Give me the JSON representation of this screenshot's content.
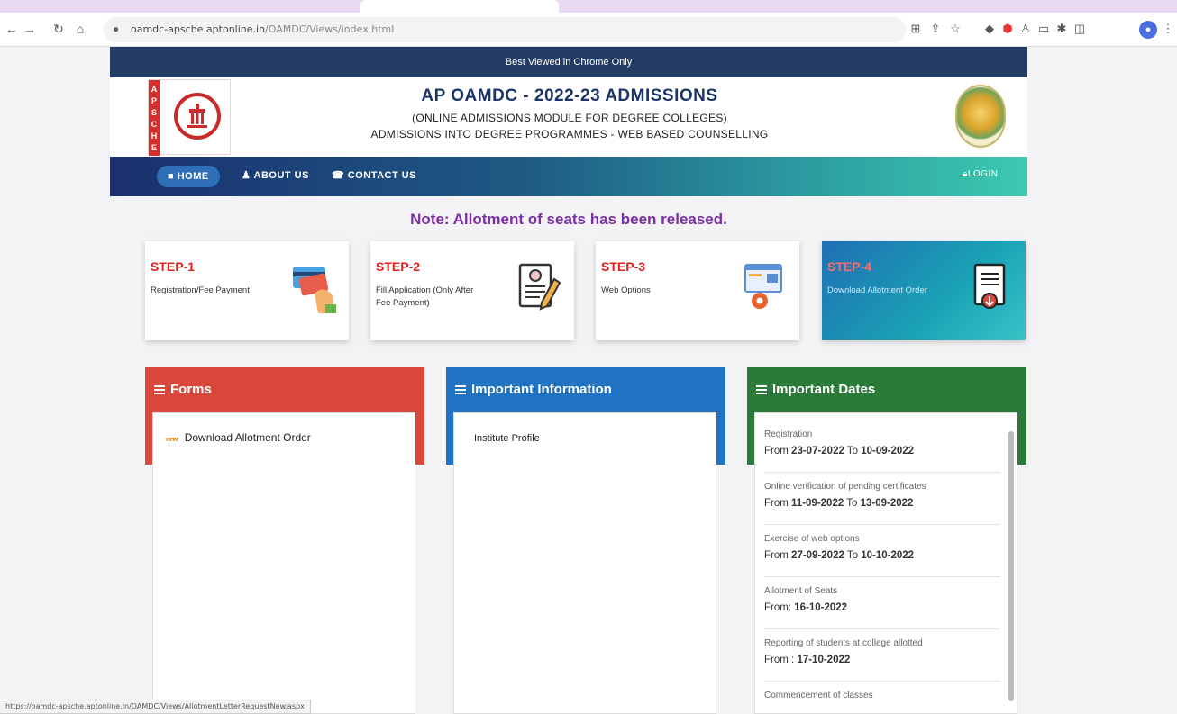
{
  "browser": {
    "url_host": "oamdc-apsche.aptonline.in",
    "url_path": "/OAMDC/Views/index.html",
    "status_url": "https://oamdc-apsche.aptonline.in/OAMDC/Views/AllotmentLetterRequestNew.aspx"
  },
  "site": {
    "notice": "Best Viewed in Chrome Only",
    "title": "AP OAMDC - 2022-23 ADMISSIONS",
    "subtitle1": "(ONLINE ADMISSIONS MODULE FOR DEGREE COLLEGES)",
    "subtitle2": "ADMISSIONS INTO DEGREE PROGRAMMES - WEB BASED COUNSELLING",
    "logo_letters": [
      "A",
      "P",
      "S",
      "C",
      "H",
      "E"
    ]
  },
  "nav": {
    "home": "HOME",
    "about": "ABOUT US",
    "contact": "CONTACT US",
    "login": "LOGIN"
  },
  "note": "Note: Allotment of seats has been released.",
  "steps": [
    {
      "label": "STEP-1",
      "desc": "Registration/Fee Payment"
    },
    {
      "label": "STEP-2",
      "desc": "Fill Application (Only After Fee Payment)"
    },
    {
      "label": "STEP-3",
      "desc": "Web Options"
    },
    {
      "label": "STEP-4",
      "desc": "Download Allotment Order"
    }
  ],
  "panels": {
    "forms": {
      "title": "Forms",
      "badge": "new",
      "link": "Download Allotment Order"
    },
    "info": {
      "title": "Important Information",
      "link": "Institute Profile"
    },
    "dates": {
      "title": "Important Dates",
      "items": [
        {
          "label": "Registration",
          "prefix": "From",
          "from": "23-07-2022",
          "sep": "To",
          "to": "10-09-2022"
        },
        {
          "label": "Online verification of pending certificates",
          "prefix": "From",
          "from": "11-09-2022",
          "sep": "To",
          "to": "13-09-2022"
        },
        {
          "label": "Exercise of web options",
          "prefix": "From",
          "from": "27-09-2022",
          "sep": "To",
          "to": "10-10-2022"
        },
        {
          "label": "Allotment of Seats",
          "prefix": "From:",
          "from": "16-10-2022",
          "sep": "",
          "to": ""
        },
        {
          "label": "Reporting of students at college allotted",
          "prefix": "From :",
          "from": "17-10-2022",
          "sep": "",
          "to": ""
        },
        {
          "label": "Commencement of classes",
          "prefix": "",
          "from": "",
          "sep": "",
          "to": ""
        }
      ]
    }
  },
  "colors": {
    "header_bar": "#233c63",
    "title": "#1b3566",
    "note": "#7b2fa2",
    "step_label": "#e02020",
    "forms": "#d9473a",
    "info": "#1f73c2",
    "dates": "#2c7a3a"
  }
}
